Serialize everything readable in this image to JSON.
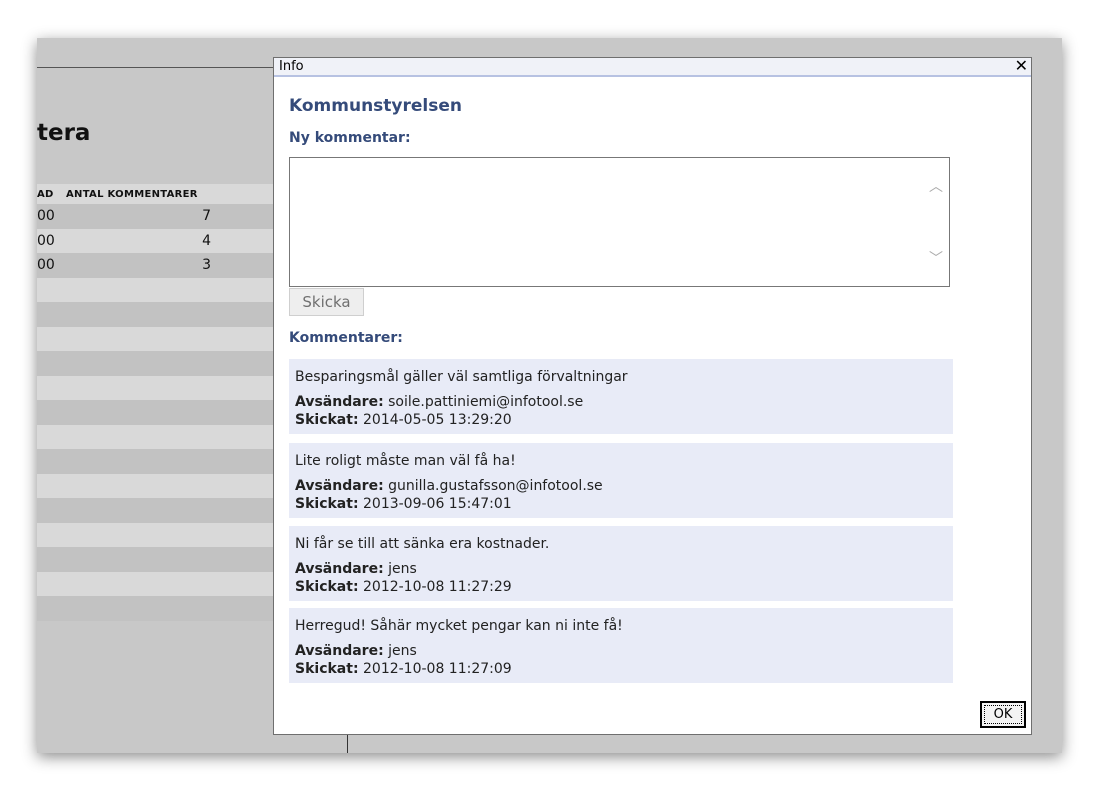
{
  "background": {
    "title": "tera",
    "table": {
      "headers": [
        "AD",
        "ANTAL KOMMENTARER"
      ],
      "rows": [
        {
          "c1": "00",
          "c2": "7"
        },
        {
          "c1": "00",
          "c2": "4"
        },
        {
          "c1": "00",
          "c2": "3"
        }
      ]
    }
  },
  "dialog": {
    "title": "Info",
    "close": "✕",
    "heading": "Kommunstyrelsen",
    "new_comment_label": "Ny kommentar:",
    "send_label": "Skicka",
    "comments_label": "Kommentarer:",
    "sender_label": "Avsändare:",
    "sent_label": "Skickat:",
    "comments": [
      {
        "text": "Besparingsmål gäller väl samtliga förvaltningar",
        "sender": "soile.pattiniemi@infotool.se",
        "sent": "2014-05-05 13:29:20"
      },
      {
        "text": "Lite roligt måste man väl få ha!",
        "sender": "gunilla.gustafsson@infotool.se",
        "sent": "2013-09-06 15:47:01"
      },
      {
        "text": "Ni får se till att sänka era kostnader.",
        "sender": "jens",
        "sent": "2012-10-08 11:27:29"
      },
      {
        "text": "Herregud! Såhär mycket pengar kan ni inte få!",
        "sender": "jens",
        "sent": "2012-10-08 11:27:09"
      }
    ],
    "ok_label": "OK"
  }
}
